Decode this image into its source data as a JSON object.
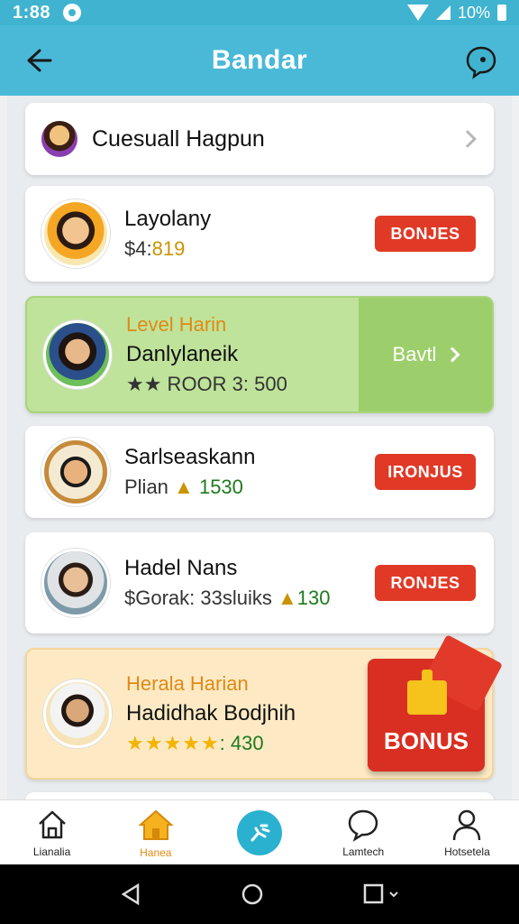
{
  "status_bar": {
    "time": "1:88",
    "battery_text": "10%"
  },
  "app_bar": {
    "title": "Bandar"
  },
  "top_card": {
    "name": "Cuesuall Hagpun"
  },
  "rows": [
    {
      "name": "Layolany",
      "sub_prefix": "$4:",
      "sub_value": "819",
      "button": "BONJES"
    },
    {
      "level": "Level Harin",
      "name": "Danlylaneik",
      "sub": "★★ ROOR 3: 500",
      "action": "Bavtl"
    },
    {
      "name": "Sarlseaskann",
      "sub_prefix": "Plian",
      "sub_value": "1530",
      "button": "IRONJUS"
    },
    {
      "name": "Hadel Nans",
      "sub_prefix": "$Gorak: 33sluiks",
      "sub_value": "130",
      "button": "RONJES"
    },
    {
      "level": "Herala Harian",
      "name": "Hadidhak Bodjhih",
      "stars": "★★★★★",
      "sub_value": ": 430",
      "bonus": "BONUS"
    }
  ],
  "bottom_nav": [
    {
      "label": "Lianalia"
    },
    {
      "label": "Hanea"
    },
    {
      "label": ""
    },
    {
      "label": "Lamtech"
    },
    {
      "label": "Hotsetela"
    }
  ],
  "colors": {
    "primary": "#4ab9d8",
    "bonus": "#e03a27",
    "active": "#e58a12"
  }
}
